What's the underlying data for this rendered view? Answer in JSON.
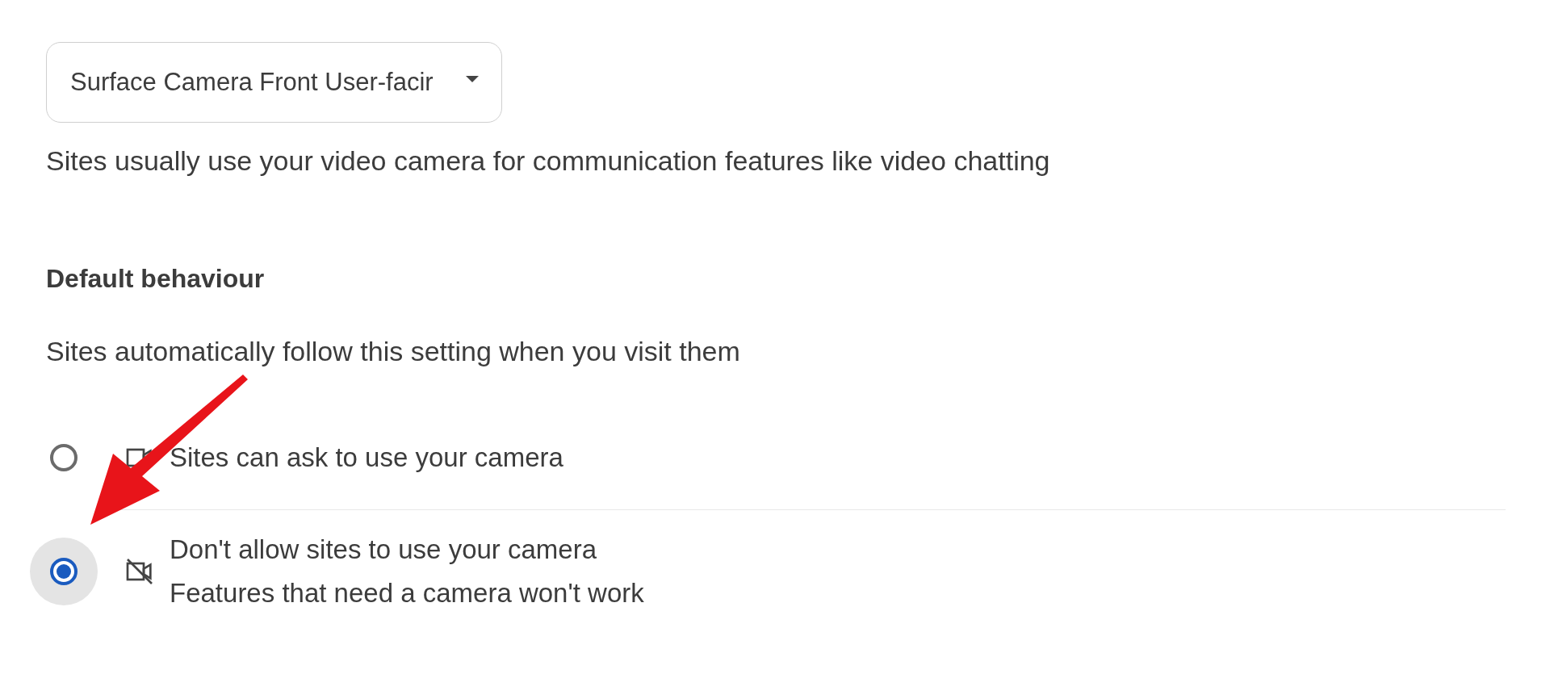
{
  "camera_select": {
    "value": "Surface Camera Front User-facir"
  },
  "description": "Sites usually use your video camera for communication features like video chatting",
  "default_behaviour": {
    "heading": "Default behaviour",
    "subtitle": "Sites automatically follow this setting when you visit them",
    "options": [
      {
        "kind": "allow",
        "label": "Sites can ask to use your camera",
        "selected": false
      },
      {
        "kind": "block",
        "label": "Don't allow sites to use your camera",
        "detail": "Features that need a camera won't work",
        "selected": true
      }
    ]
  }
}
